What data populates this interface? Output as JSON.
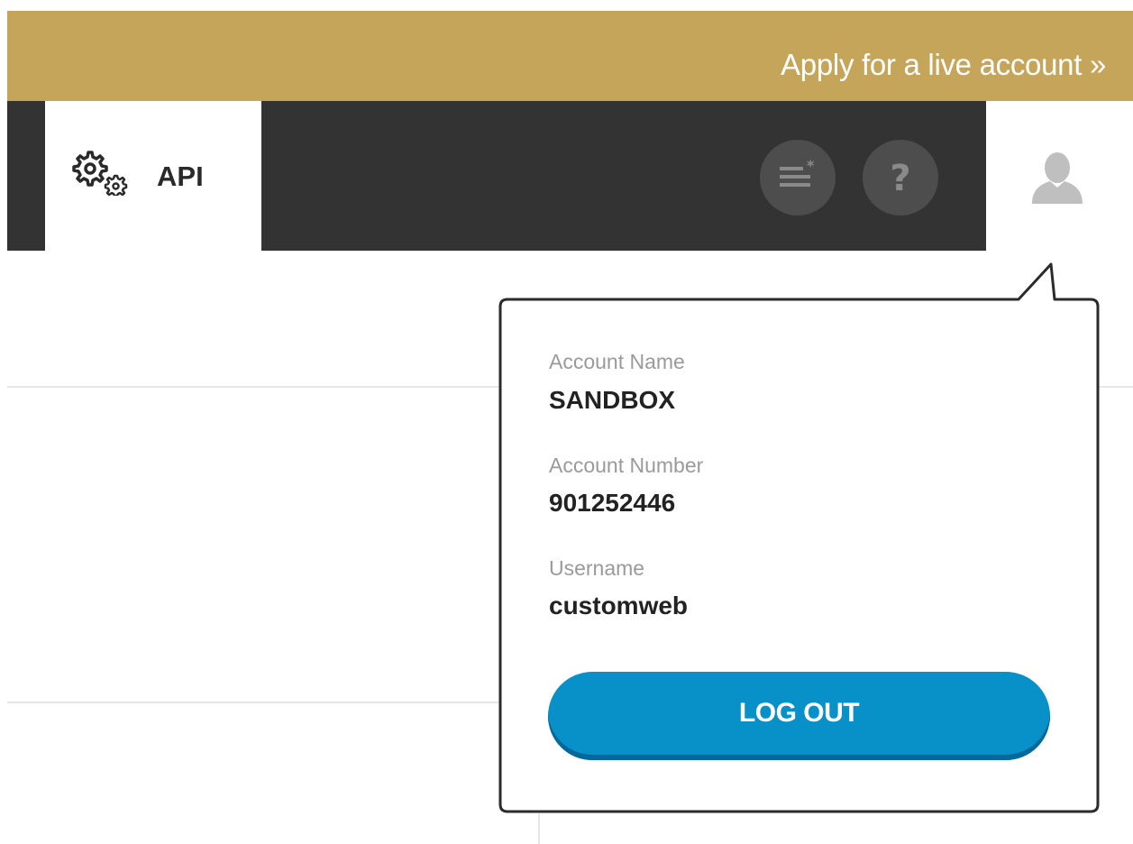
{
  "promo": {
    "text": "Apply for a live account »"
  },
  "nav": {
    "tabs": [
      {
        "label": "API",
        "icon": "gears-icon",
        "active": true
      }
    ],
    "actions": [
      {
        "icon": "notes-icon"
      },
      {
        "icon": "help-icon",
        "glyph": "?"
      }
    ],
    "user_icon": "user-icon"
  },
  "account_popup": {
    "fields": [
      {
        "label": "Account Name",
        "value": "SANDBOX"
      },
      {
        "label": "Account Number",
        "value": "901252446"
      },
      {
        "label": "Username",
        "value": "customweb"
      }
    ],
    "logout_label": "LOG OUT"
  },
  "colors": {
    "promo_bg": "#c5a55a",
    "nav_bg": "#333333",
    "nav_button_bg": "#4d4d4d",
    "user_icon": "#bfbfbf",
    "logout_bg": "#0890c8",
    "label_gray": "#9a9a9a"
  }
}
